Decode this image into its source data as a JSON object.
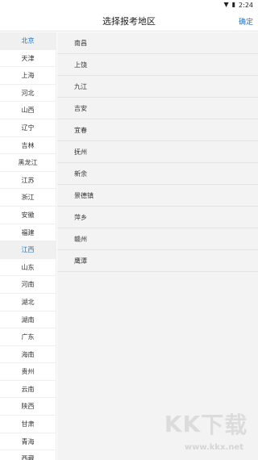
{
  "status_bar": {
    "time": "2:24",
    "wifi_icon": "wifi-icon",
    "battery_icon": "battery-icon"
  },
  "header": {
    "title": "选择报考地区",
    "confirm_label": "确定"
  },
  "provinces": [
    {
      "label": "北京",
      "active": true
    },
    {
      "label": "天津"
    },
    {
      "label": "上海"
    },
    {
      "label": "河北"
    },
    {
      "label": "山西"
    },
    {
      "label": "辽宁"
    },
    {
      "label": "吉林"
    },
    {
      "label": "黑龙江"
    },
    {
      "label": "江苏"
    },
    {
      "label": "浙江"
    },
    {
      "label": "安徽"
    },
    {
      "label": "福建"
    },
    {
      "label": "江西",
      "active": true
    },
    {
      "label": "山东"
    },
    {
      "label": "河南"
    },
    {
      "label": "湖北"
    },
    {
      "label": "湖南"
    },
    {
      "label": "广东"
    },
    {
      "label": "海南"
    },
    {
      "label": "贵州"
    },
    {
      "label": "云南"
    },
    {
      "label": "陕西"
    },
    {
      "label": "甘肃"
    },
    {
      "label": "青海"
    },
    {
      "label": "西藏"
    }
  ],
  "cities": [
    "南昌",
    "上饶",
    "九江",
    "吉安",
    "宜春",
    "抚州",
    "新余",
    "景德镇",
    "萍乡",
    "赣州",
    "鹰潭"
  ],
  "watermark": {
    "logo": "KK下载",
    "url": "www.kkx.net"
  },
  "colors": {
    "accent": "#1a73c7",
    "right_panel_bg": "#f3f3f3"
  }
}
